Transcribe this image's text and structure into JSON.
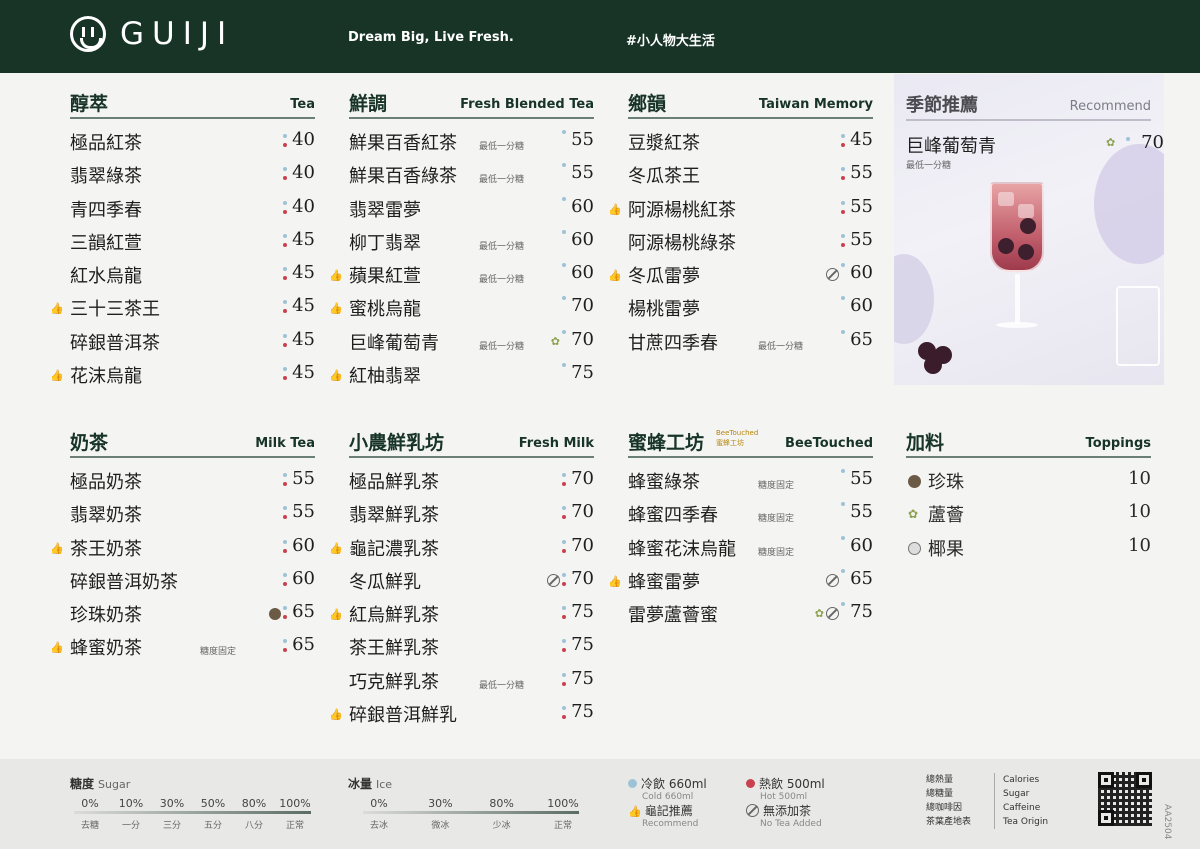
{
  "header": {
    "brand": "GUIJI",
    "slogan": "Dream Big, Live Fresh.",
    "hashtag": "#小人物大生活"
  },
  "sections": {
    "tea": {
      "title_zh": "醇萃",
      "title_en": "Tea",
      "items": [
        {
          "name": "極品紅茶",
          "price": "40",
          "temp": "both"
        },
        {
          "name": "翡翠綠茶",
          "price": "40",
          "temp": "both"
        },
        {
          "name": "青四季春",
          "price": "40",
          "temp": "both"
        },
        {
          "name": "三韻紅萱",
          "price": "45",
          "temp": "both"
        },
        {
          "name": "紅水烏龍",
          "price": "45",
          "temp": "both"
        },
        {
          "name": "三十三茶王",
          "price": "45",
          "temp": "both",
          "recommended": true
        },
        {
          "name": "碎銀普洱茶",
          "price": "45",
          "temp": "both"
        },
        {
          "name": "花沫烏龍",
          "price": "45",
          "temp": "both",
          "recommended": true
        }
      ]
    },
    "blended": {
      "title_zh": "鮮調",
      "title_en": "Fresh Blended Tea",
      "items": [
        {
          "name": "鮮果百香紅茶",
          "note": "最低一分糖",
          "price": "55",
          "temp": "cold"
        },
        {
          "name": "鮮果百香綠茶",
          "note": "最低一分糖",
          "price": "55",
          "temp": "cold"
        },
        {
          "name": "翡翠雷夢",
          "note": "",
          "price": "60",
          "temp": "cold"
        },
        {
          "name": "柳丁翡翠",
          "note": "最低一分糖",
          "price": "60",
          "temp": "cold"
        },
        {
          "name": "蘋果紅萱",
          "note": "最低一分糖",
          "price": "60",
          "temp": "cold",
          "recommended": true
        },
        {
          "name": "蜜桃烏龍",
          "note": "",
          "price": "70",
          "temp": "cold",
          "recommended": true
        },
        {
          "name": "巨峰葡萄青",
          "note": "最低一分糖",
          "price": "70",
          "temp": "cold",
          "aloe": true
        },
        {
          "name": "紅柚翡翠",
          "note": "",
          "price": "75",
          "temp": "cold",
          "recommended": true
        }
      ]
    },
    "taiwan": {
      "title_zh": "鄉韻",
      "title_en": "Taiwan Memory",
      "items": [
        {
          "name": "豆漿紅茶",
          "price": "45",
          "temp": "both"
        },
        {
          "name": "冬瓜茶王",
          "price": "55",
          "temp": "both"
        },
        {
          "name": "阿源楊桃紅茶",
          "price": "55",
          "temp": "both",
          "recommended": true
        },
        {
          "name": "阿源楊桃綠茶",
          "price": "55",
          "temp": "both"
        },
        {
          "name": "冬瓜雷夢",
          "price": "60",
          "temp": "cold",
          "recommended": true,
          "no_tea": true
        },
        {
          "name": "楊桃雷夢",
          "price": "60",
          "temp": "cold"
        },
        {
          "name": "甘蔗四季春",
          "note": "最低一分糖",
          "price": "65",
          "temp": "cold"
        }
      ]
    },
    "milktea": {
      "title_zh": "奶茶",
      "title_en": "Milk Tea",
      "items": [
        {
          "name": "極品奶茶",
          "price": "55",
          "temp": "both"
        },
        {
          "name": "翡翠奶茶",
          "price": "55",
          "temp": "both"
        },
        {
          "name": "茶王奶茶",
          "price": "60",
          "temp": "both",
          "recommended": true
        },
        {
          "name": "碎銀普洱奶茶",
          "price": "60",
          "temp": "both"
        },
        {
          "name": "珍珠奶茶",
          "price": "65",
          "temp": "both",
          "pearl": true
        },
        {
          "name": "蜂蜜奶茶",
          "note": "糖度固定",
          "price": "65",
          "temp": "both",
          "recommended": true
        }
      ]
    },
    "freshmilk": {
      "title_zh": "小農鮮乳坊",
      "title_en": "Fresh Milk",
      "items": [
        {
          "name": "極品鮮乳茶",
          "price": "70",
          "temp": "both"
        },
        {
          "name": "翡翠鮮乳茶",
          "price": "70",
          "temp": "both"
        },
        {
          "name": "龜記濃乳茶",
          "price": "70",
          "temp": "both",
          "recommended": true
        },
        {
          "name": "冬瓜鮮乳",
          "price": "70",
          "temp": "both",
          "no_tea": true
        },
        {
          "name": "紅烏鮮乳茶",
          "price": "75",
          "temp": "both",
          "recommended": true
        },
        {
          "name": "茶王鮮乳茶",
          "price": "75",
          "temp": "both"
        },
        {
          "name": "巧克鮮乳茶",
          "note": "最低一分糖",
          "price": "75",
          "temp": "both"
        },
        {
          "name": "碎銀普洱鮮乳",
          "price": "75",
          "temp": "both",
          "recommended": true
        }
      ]
    },
    "honey": {
      "title_zh": "蜜蜂工坊",
      "title_en": "BeeTouched",
      "badge": "BeeTouched 蜜蜂工坊",
      "items": [
        {
          "name": "蜂蜜綠茶",
          "note": "糖度固定",
          "price": "55",
          "temp": "cold"
        },
        {
          "name": "蜂蜜四季春",
          "note": "糖度固定",
          "price": "55",
          "temp": "cold"
        },
        {
          "name": "蜂蜜花沫烏龍",
          "note": "糖度固定",
          "price": "60",
          "temp": "cold"
        },
        {
          "name": "蜂蜜雷夢",
          "note": "",
          "price": "65",
          "temp": "cold",
          "recommended": true,
          "no_tea": true
        },
        {
          "name": "雷夢蘆薈蜜",
          "note": "",
          "price": "75",
          "temp": "cold",
          "aloe": true,
          "no_tea": true
        }
      ]
    }
  },
  "recommend": {
    "title_zh": "季節推薦",
    "title_en": "Recommend",
    "name": "巨峰葡萄青",
    "note": "最低一分糖",
    "price": "70"
  },
  "toppings": {
    "title_zh": "加料",
    "title_en": "Toppings",
    "items": [
      {
        "name": "珍珠",
        "price": "10",
        "icon": "pearl-icon"
      },
      {
        "name": "蘆薈",
        "price": "10",
        "icon": "aloe-icon"
      },
      {
        "name": "椰果",
        "price": "10",
        "icon": "coconut-icon"
      }
    ]
  },
  "footer": {
    "sugar": {
      "title_zh": "糖度",
      "title_en": "Sugar",
      "values": [
        "0%",
        "10%",
        "30%",
        "50%",
        "80%",
        "100%"
      ],
      "labels": [
        "去糖",
        "一分",
        "三分",
        "五分",
        "八分",
        "正常"
      ]
    },
    "ice": {
      "title_zh": "冰量",
      "title_en": "Ice",
      "values": [
        "0%",
        "30%",
        "80%",
        "100%"
      ],
      "labels": [
        "去冰",
        "微冰",
        "少冰",
        "正常"
      ]
    },
    "legend": {
      "cold_zh": "冷飲 660ml",
      "cold_en": "Cold 660ml",
      "hot_zh": "熱飲 500ml",
      "hot_en": "Hot 500ml",
      "rec_zh": "龜記推薦",
      "rec_en": "Recommend",
      "notea_zh": "無添加茶",
      "notea_en": "No Tea Added"
    },
    "nutrition_zh": [
      "總熱量",
      "總糖量",
      "總咖啡因",
      "茶葉產地表"
    ],
    "nutrition_en": [
      "Calories",
      "Sugar",
      "Caffeine",
      "Tea Origin"
    ],
    "code": "AA2504"
  },
  "colors": {
    "header_bg": "#173427",
    "cold_dot": "#9ec3d6",
    "hot_dot": "#c9414f",
    "accent": "#173427"
  }
}
